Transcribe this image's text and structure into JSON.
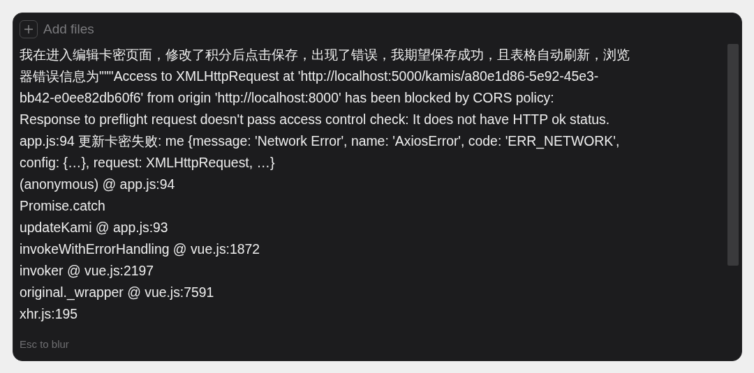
{
  "attach": {
    "label": "Add files"
  },
  "message_lines": [
    "我在进入编辑卡密页面，修改了积分后点击保存，出现了错误，我期望保存成功，且表格自动刷新，浏览",
    "器错误信息为\"\"\"Access to XMLHttpRequest at 'http://localhost:5000/kamis/a80e1d86-5e92-45e3-",
    "bb42-e0ee82db60f6' from origin 'http://localhost:8000' has been blocked by CORS policy:",
    "Response to preflight request doesn't pass access control check: It does not have HTTP ok status.",
    "app.js:94 更新卡密失败: me {message: 'Network Error', name: 'AxiosError', code: 'ERR_NETWORK',",
    "config: {…}, request: XMLHttpRequest, …}",
    "(anonymous) @ app.js:94",
    "Promise.catch",
    "updateKami @ app.js:93",
    "invokeWithErrorHandling @ vue.js:1872",
    "invoker @ vue.js:2197",
    "original._wrapper @ vue.js:7591",
    "xhr.js:195"
  ],
  "hint": "Esc to blur"
}
